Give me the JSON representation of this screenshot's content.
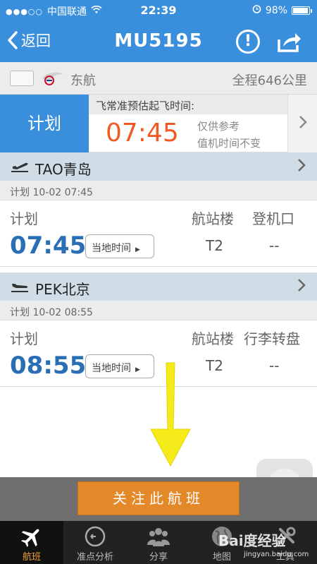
{
  "status_bar": {
    "carrier": "中国联通",
    "time": "22:39",
    "battery": "98%",
    "battery_level": 0.98
  },
  "nav": {
    "back_label": "返回",
    "title": "MU5195"
  },
  "airline": {
    "name": "东航",
    "distance": "全程646公里"
  },
  "estimate": {
    "plan_label": "计划",
    "label": "飞常准预估起飞时间:",
    "time": "07:45",
    "note1": "仅供参考",
    "note2": "值机时间不变"
  },
  "departure": {
    "city": "TAO青岛",
    "planned": "计划 10-02 07:45",
    "plan_label": "计划",
    "time": "07:45",
    "tz_label": "当地时间",
    "col2_label": "航站楼",
    "col2_value": "T2",
    "col3_label": "登机口",
    "col3_value": "--"
  },
  "arrival": {
    "city": "PEK北京",
    "planned": "计划 10-02 08:55",
    "plan_label": "计划",
    "time": "08:55",
    "tz_label": "当地时间",
    "col2_label": "航站楼",
    "col2_value": "T2",
    "col3_label": "行李转盘",
    "col3_value": "--"
  },
  "follow_button": "关注此航班",
  "tabs": [
    {
      "label": "航班",
      "icon": "plane-icon"
    },
    {
      "label": "准点分析",
      "icon": "clock-icon"
    },
    {
      "label": "分享",
      "icon": "people-icon"
    },
    {
      "label": "地图",
      "icon": "globe-icon"
    },
    {
      "label": "工具",
      "icon": "tools-icon"
    }
  ],
  "watermark": {
    "brand": "Bai度经验",
    "url": "jingyan.baidu.com"
  },
  "colors": {
    "accent": "#3a8fdd",
    "estimate_time": "#f05a24",
    "time_blue": "#2a6fb5",
    "follow_button": "#e4892a",
    "active_tab": "#f2a23a"
  }
}
